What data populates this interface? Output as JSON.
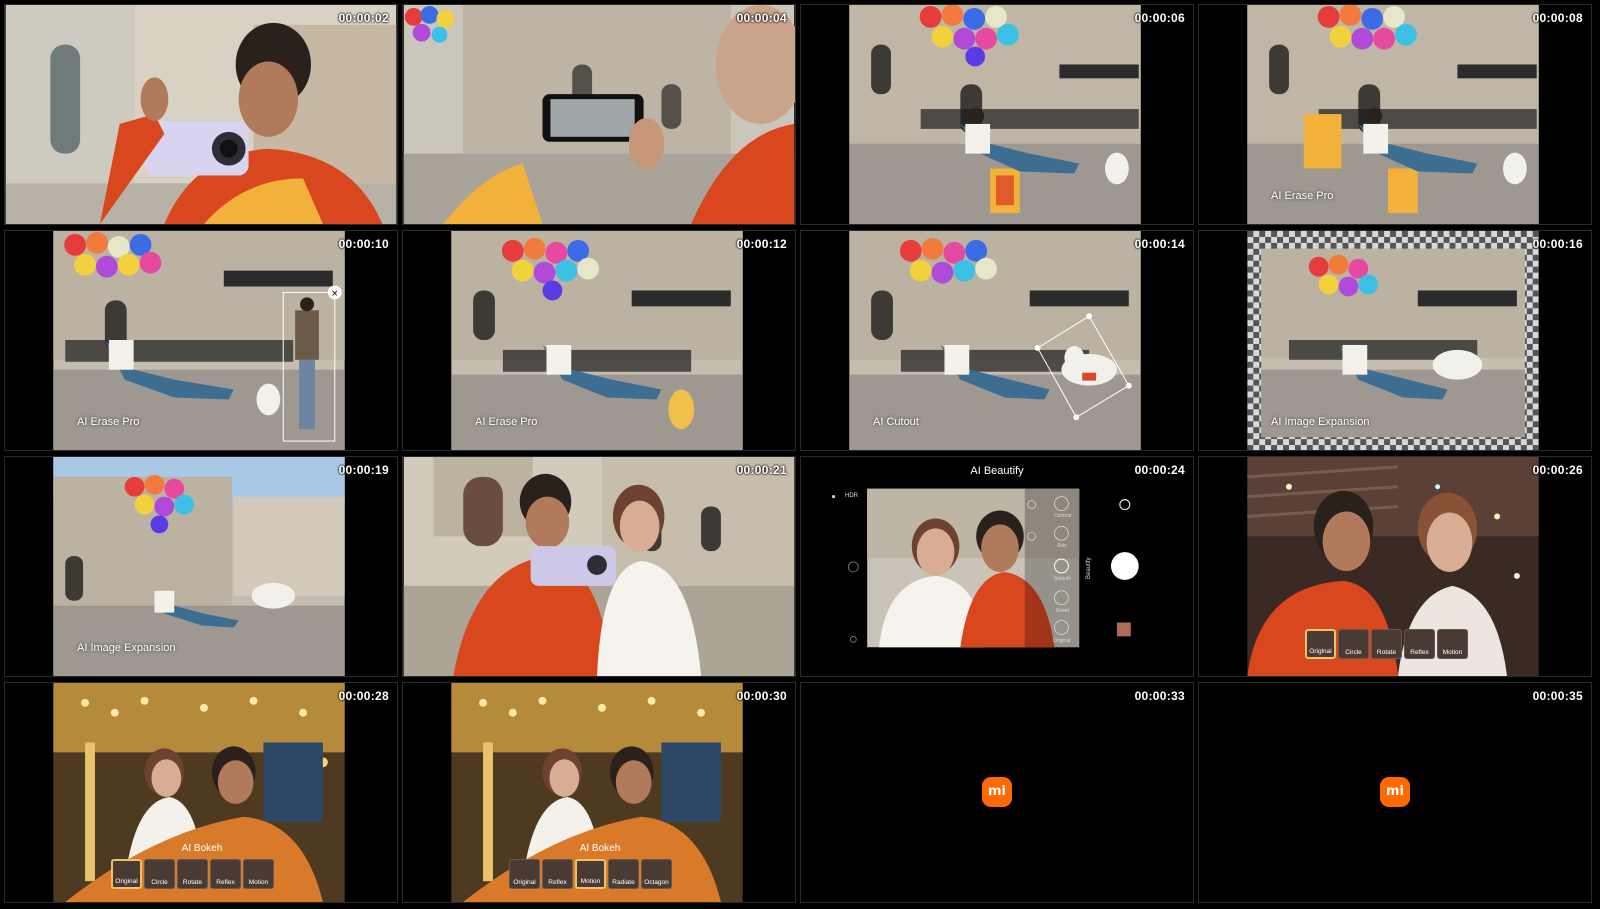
{
  "frames": [
    {
      "time": "00:00:02",
      "caption": ""
    },
    {
      "time": "00:00:04",
      "caption": ""
    },
    {
      "time": "00:00:06",
      "caption": ""
    },
    {
      "time": "00:00:08",
      "caption": "AI Erase Pro"
    },
    {
      "time": "00:00:10",
      "caption": "AI Erase Pro"
    },
    {
      "time": "00:00:12",
      "caption": "AI Erase Pro"
    },
    {
      "time": "00:00:14",
      "caption": "AI Cutout"
    },
    {
      "time": "00:00:16",
      "caption": "AI Image Expansion"
    },
    {
      "time": "00:00:19",
      "caption": "AI Image Expansion"
    },
    {
      "time": "00:00:21",
      "caption": ""
    },
    {
      "time": "00:00:24",
      "caption": "AI Beautify"
    },
    {
      "time": "00:00:26",
      "caption": ""
    },
    {
      "time": "00:00:28",
      "caption": "AI Bokeh"
    },
    {
      "time": "00:00:30",
      "caption": "AI Bokeh"
    },
    {
      "time": "00:00:33",
      "caption": ""
    },
    {
      "time": "00:00:35",
      "caption": ""
    }
  ],
  "beautify": {
    "hdr": "HDR",
    "side": "Beautify",
    "menu": [
      "Contour",
      "Skin",
      "Smooth",
      "Reset",
      "Original"
    ]
  },
  "bokeh_chips_1": [
    "Original",
    "Circle",
    "Rotate",
    "Reflex",
    "Motion"
  ],
  "bokeh_chips_2": [
    "Original",
    "Circle",
    "Rotate",
    "Reflex",
    "Motion"
  ],
  "bokeh_chips_3": [
    "Original",
    "Reflex",
    "Motion",
    "Radiate",
    "Octagon"
  ],
  "logo": "mi",
  "colors": {
    "accent": "#ff6900",
    "chip_selected": "#e8c36b"
  }
}
